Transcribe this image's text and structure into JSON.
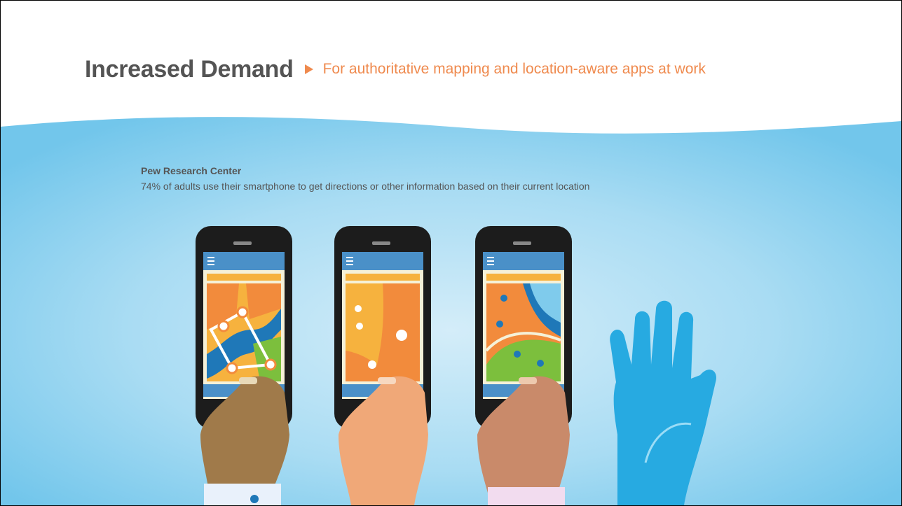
{
  "slide": {
    "title": "Increased Demand",
    "subtitle": "For authoritative mapping and location-aware apps at work",
    "source": "Pew Research Center",
    "stat": "74% of adults use their smartphone to get directions or other information based on their current location"
  },
  "colors": {
    "title": "#545454",
    "accent": "#ef8a4e",
    "sky": "#7fcbec",
    "phone": "#1c1c1c",
    "screen_bar": "#4a90c8",
    "map_orange": "#f28b3c",
    "map_yellow": "#f6b23e",
    "map_blue": "#1f78b8",
    "map_green": "#7cbf3d",
    "glove": "#27aae1"
  },
  "illustration": {
    "items": [
      "phone-in-hand-icon",
      "phone-in-hand-icon",
      "phone-in-hand-icon",
      "raised-hand-icon"
    ]
  }
}
